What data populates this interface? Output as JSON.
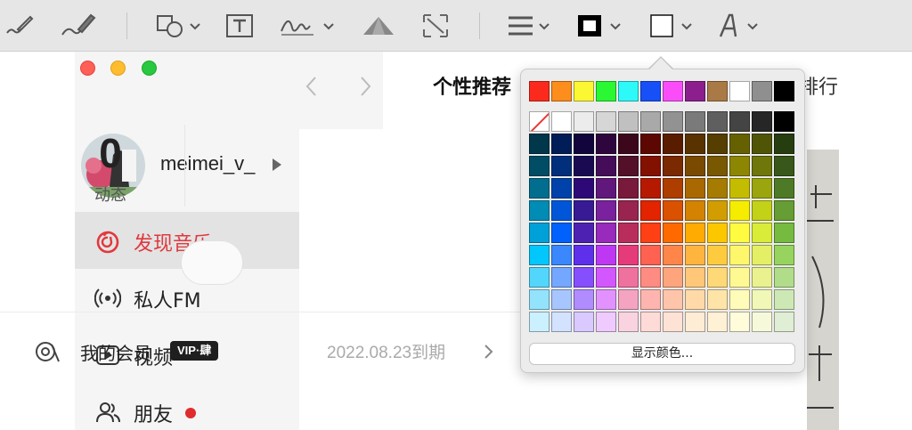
{
  "toolbar": {
    "tools": [
      {
        "name": "sketch-icon"
      },
      {
        "name": "draw-icon"
      },
      {
        "name": "shapes-icon"
      },
      {
        "name": "text-box-icon"
      },
      {
        "name": "sign-icon"
      },
      {
        "name": "adjust-color-icon"
      },
      {
        "name": "resize-icon"
      },
      {
        "name": "shape-style-icon"
      },
      {
        "name": "border-color-icon"
      },
      {
        "name": "fill-color-icon"
      },
      {
        "name": "text-style-icon"
      }
    ]
  },
  "app": {
    "user": {
      "name": "meimei_v_"
    },
    "nav": [
      {
        "label": "发现音乐",
        "icon": "netease-music-icon"
      },
      {
        "label": "私人FM",
        "icon": "radio-icon"
      },
      {
        "label": "视频",
        "icon": "video-icon"
      },
      {
        "label": "朋友",
        "icon": "friends-icon"
      }
    ],
    "header": {
      "tab_recommend": "个性推荐",
      "tab_rank": "排行"
    },
    "profile": {
      "stat_value": "0",
      "stat_label": "动态",
      "vip_label": "我的会员",
      "vip_badge": "VIP·肆",
      "vip_expire": "2022.08.23到期"
    }
  },
  "color_picker": {
    "primary": [
      "#fc2a1c",
      "#fd8d1c",
      "#fbf732",
      "#29f833",
      "#2df9f9",
      "#1750f7",
      "#fa4df9",
      "#8c1f8d",
      "#a97a45",
      "#ffffff",
      "#8f8f8f",
      "#000000"
    ],
    "grays": [
      "none",
      "#ffffff",
      "#ececec",
      "#d6d6d6",
      "#c0c0c0",
      "#a9a9a9",
      "#929292",
      "#7a7a7a",
      "#5f5f5f",
      "#444444",
      "#262626",
      "#000000"
    ],
    "columns": [
      [
        "#00374a",
        "#004d65",
        "#016e8f",
        "#008cb4",
        "#00a1d8",
        "#01c7fc",
        "#52d6fc",
        "#93e3fd",
        "#cbf0ff"
      ],
      [
        "#011d57",
        "#012f7b",
        "#0042a9",
        "#0056d6",
        "#0061fd",
        "#3a87fe",
        "#74a7ff",
        "#a7c6ff",
        "#d3e2ff"
      ],
      [
        "#11053b",
        "#1a0a52",
        "#2c0977",
        "#371a94",
        "#4d22b2",
        "#5e30eb",
        "#864ffe",
        "#b18cfe",
        "#d9c9fe"
      ],
      [
        "#2e063d",
        "#450d59",
        "#61187c",
        "#7a219e",
        "#982abc",
        "#be38f3",
        "#d357fe",
        "#e292fe",
        "#efcaff"
      ],
      [
        "#3c071b",
        "#551029",
        "#791a3d",
        "#99244f",
        "#b92d5d",
        "#e63b7a",
        "#ee719e",
        "#f4a4c0",
        "#f9d3e0"
      ],
      [
        "#5c0701",
        "#831100",
        "#b51a00",
        "#e22400",
        "#ff4015",
        "#ff6250",
        "#ff8c82",
        "#ffb5af",
        "#ffdbd8"
      ],
      [
        "#5a1c00",
        "#7b2900",
        "#ad3e00",
        "#da5100",
        "#ff6a00",
        "#ff8648",
        "#ffa57d",
        "#ffc5ab",
        "#ffe2d6"
      ],
      [
        "#583300",
        "#7a4a00",
        "#a96800",
        "#d38301",
        "#ffab01",
        "#feb43f",
        "#ffc777",
        "#ffd9a8",
        "#ffecd4"
      ],
      [
        "#563d00",
        "#785800",
        "#a67b01",
        "#d19d01",
        "#fdc700",
        "#fecb3e",
        "#ffd977",
        "#ffe4a8",
        "#fff1d5"
      ],
      [
        "#666100",
        "#8d8602",
        "#c4bc00",
        "#f5ec00",
        "#fefb41",
        "#fff76b",
        "#fff994",
        "#fffbb9",
        "#fffcdc"
      ],
      [
        "#4f5504",
        "#6f760a",
        "#9ba50e",
        "#c3d117",
        "#d9ec37",
        "#e4ef65",
        "#eaf28f",
        "#f1f7b7",
        "#f6fadb"
      ],
      [
        "#263e0f",
        "#38571a",
        "#4e7a27",
        "#669d34",
        "#76bb40",
        "#96d35f",
        "#b1dd8b",
        "#cde8b5",
        "#dfeed4"
      ]
    ],
    "show_colors_label": "显示颜色..."
  }
}
